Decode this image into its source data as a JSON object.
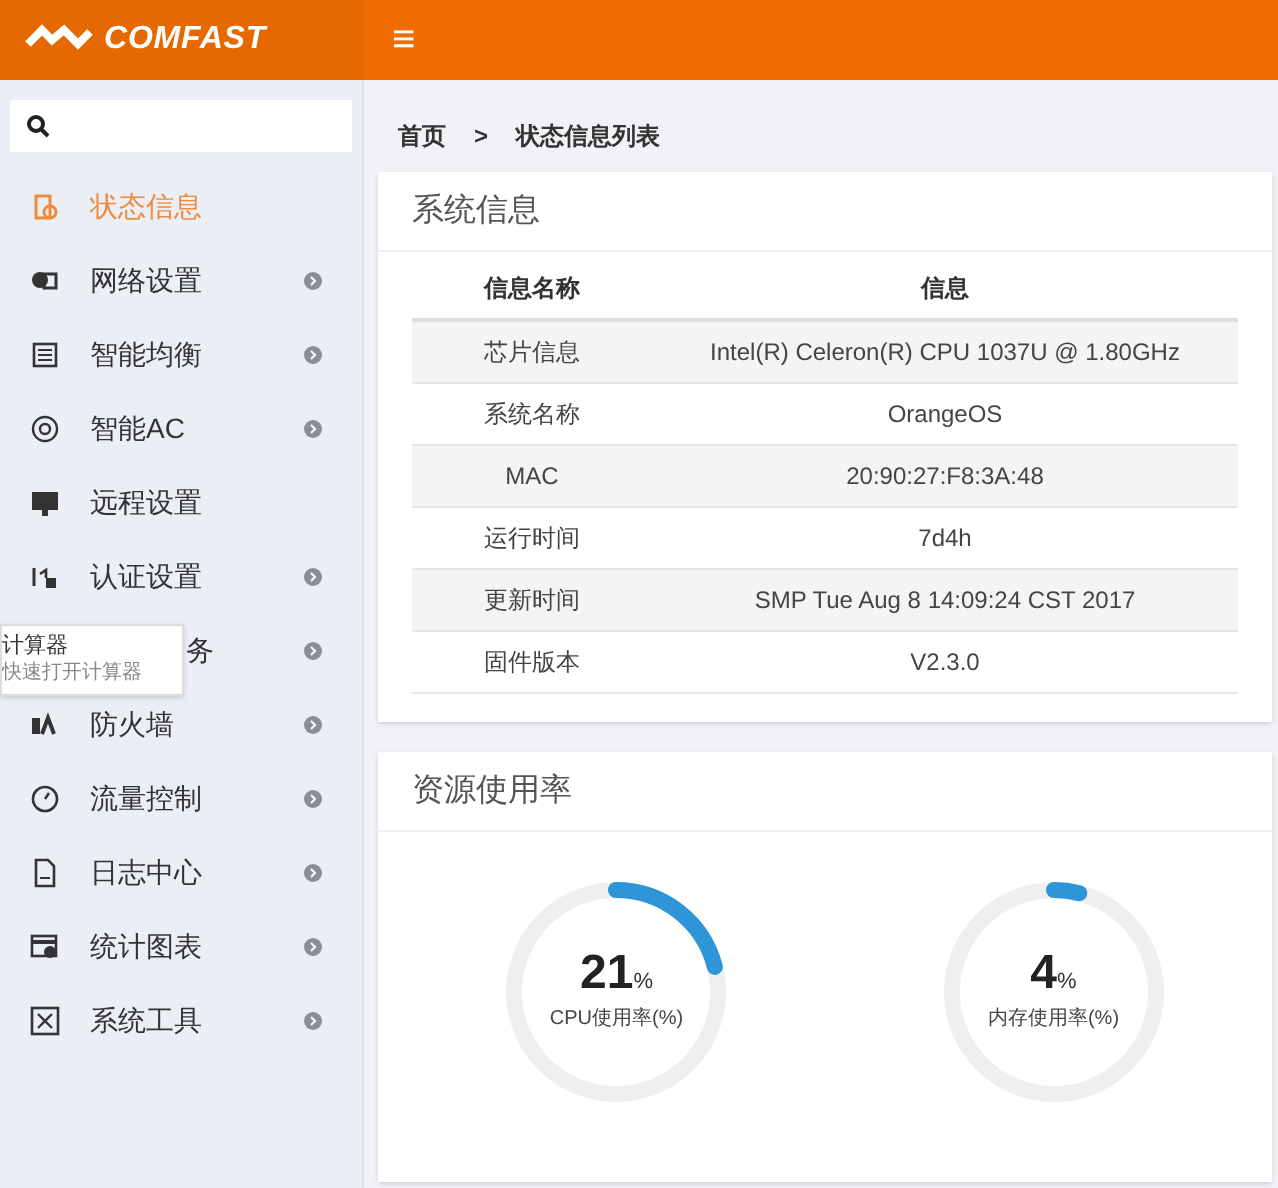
{
  "header": {
    "logo": "COMFAST",
    "menu_glyph": "≡"
  },
  "sidebar": {
    "items": [
      {
        "label": "状态信息",
        "selected": true,
        "arrow": false
      },
      {
        "label": "网络设置",
        "selected": false,
        "arrow": true
      },
      {
        "label": "智能均衡",
        "selected": false,
        "arrow": true
      },
      {
        "label": "智能AC",
        "selected": false,
        "arrow": true
      },
      {
        "label": "远程设置",
        "selected": false,
        "arrow": false
      },
      {
        "label": "认证设置",
        "selected": false,
        "arrow": true
      },
      {
        "label": "务",
        "selected": false,
        "arrow": true
      },
      {
        "label": "防火墙",
        "selected": false,
        "arrow": true
      },
      {
        "label": "流量控制",
        "selected": false,
        "arrow": true
      },
      {
        "label": "日志中心",
        "selected": false,
        "arrow": true
      },
      {
        "label": "统计图表",
        "selected": false,
        "arrow": true
      },
      {
        "label": "系统工具",
        "selected": false,
        "arrow": true
      }
    ],
    "tooltip": {
      "title": "计算器",
      "subtitle": "快速打开计算器"
    }
  },
  "breadcrumb": [
    "首页",
    ">",
    "状态信息列表"
  ],
  "system_info": {
    "title": "系统信息",
    "columns": [
      "信息名称",
      "信息"
    ],
    "rows": [
      [
        "芯片信息",
        "Intel(R) Celeron(R) CPU 1037U @ 1.80GHz"
      ],
      [
        "系统名称",
        "OrangeOS"
      ],
      [
        "MAC",
        "20:90:27:F8:3A:48"
      ],
      [
        "运行时间",
        "7d4h"
      ],
      [
        "更新时间",
        "SMP Tue Aug 8 14:09:24 CST 2017"
      ],
      [
        "固件版本",
        "V2.3.0"
      ]
    ]
  },
  "resources": {
    "title": "资源使用率",
    "gauges": [
      {
        "value": "21",
        "unit": "%",
        "label": "CPU使用率(%)",
        "level": 0.21
      },
      {
        "value": "4",
        "unit": "%",
        "label": "内存使用率(%)",
        "level": 0.04
      }
    ]
  }
}
